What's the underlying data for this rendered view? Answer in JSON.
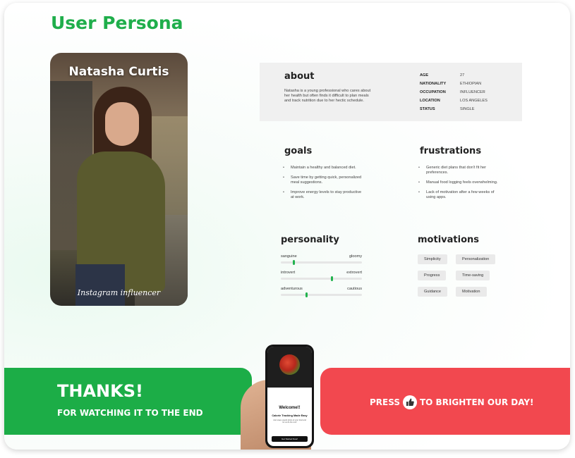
{
  "title": "User Persona",
  "persona": {
    "name": "Natasha Curtis",
    "caption": "Instagram influencer"
  },
  "about": {
    "heading": "about",
    "description": "Natasha is a young professional who cares about her health but often finds it difficult to plan meals and track nutrition due to her hectic schedule.",
    "facts": [
      {
        "label": "AGE",
        "value": "27"
      },
      {
        "label": "NATIONALITY",
        "value": "ETHIOPIAN"
      },
      {
        "label": "OCCUPATION",
        "value": "INFLUENCER"
      },
      {
        "label": "LOCATION",
        "value": "LOS ANGELES"
      },
      {
        "label": "STATUS",
        "value": "SINGLE"
      }
    ]
  },
  "goals": {
    "heading": "goals",
    "items": [
      "Maintain a healthy and balanced diet.",
      "Save time by getting quick, personalized meal suggestions.",
      "Improve energy levels to stay productive at work."
    ]
  },
  "frustrations": {
    "heading": "frustrations",
    "items": [
      "Generic diet plans that don't fit her preferences.",
      "Manual food logging feels overwhelming.",
      "Lack of motivation after a few weeks of using apps."
    ]
  },
  "personality": {
    "heading": "personality",
    "traits": [
      {
        "left": "sanguine",
        "right": "gloomy",
        "level": 0.15
      },
      {
        "left": "introvert",
        "right": "extrovert",
        "level": 0.62
      },
      {
        "left": "adventurous",
        "right": "cautious",
        "level": 0.3
      }
    ]
  },
  "motivations": {
    "heading": "motivations",
    "tags": [
      "Simplicity",
      "Personalization",
      "Progress",
      "Time-saving",
      "Guidance",
      "Motivation"
    ]
  },
  "banner": {
    "thanks": "THANKS!",
    "thanks_sub": "FOR WATCHING IT TO THE END",
    "press": "PRESS",
    "brighten": "TO BRIGHTEN OUR DAY!"
  },
  "phone": {
    "welcome": "Welcome!!",
    "subtitle": "Calorie Tracking Made Easy",
    "body": "Just snap a quick photo of your food and let us do the rest!",
    "cta": "Get Started Now!"
  },
  "colors": {
    "brand_green": "#1fae4b",
    "accent_red": "#f2484f"
  },
  "icons": [
    "thumbs-up-icon"
  ]
}
